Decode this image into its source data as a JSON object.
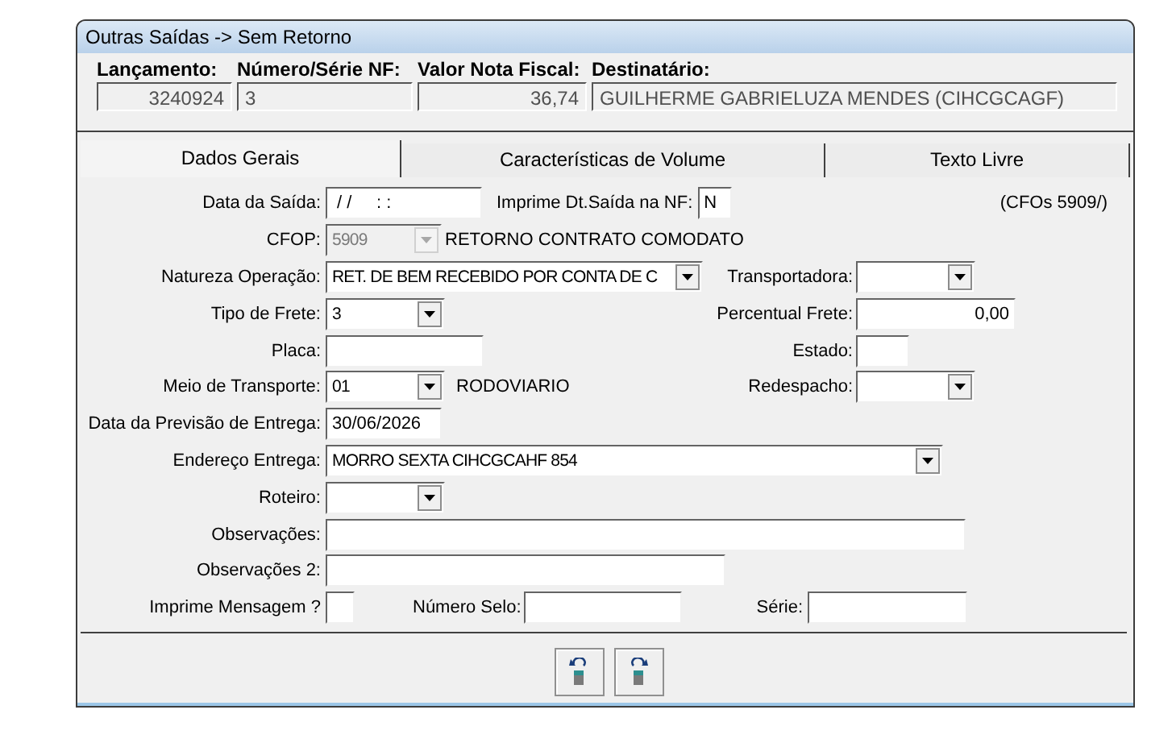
{
  "window": {
    "title": "Outras Saídas -> Sem Retorno"
  },
  "header": [
    {
      "label": "Lançamento:",
      "value": "3240924"
    },
    {
      "label": "Número/Série NF:",
      "value": "3"
    },
    {
      "label": "Valor Nota Fiscal:",
      "value": "36,74"
    },
    {
      "label": "Destinatário:",
      "value": "GUILHERME GABRIELUZA MENDES (CIHCGCAGF)"
    }
  ],
  "tabs": [
    {
      "label": "Dados Gerais",
      "selected": true
    },
    {
      "label": "Características de Volume",
      "selected": false
    },
    {
      "label": "Texto Livre",
      "selected": false
    }
  ],
  "form": {
    "data_saida": {
      "label": "Data da Saída:",
      "value": " / /     : :"
    },
    "imprime_data": {
      "label": "Imprime Dt.Saída na NF:",
      "value": "N"
    },
    "cfos_note": "(CFOs  5909/)",
    "cfop": {
      "label": "CFOP:",
      "value": "5909",
      "disabled": true,
      "description": "RETORNO CONTRATO COMODATO"
    },
    "natureza": {
      "label": "Natureza Operação:",
      "value": "RET. DE BEM RECEBIDO POR CONTA DE C"
    },
    "transportadora": {
      "label": "Transportadora:"
    },
    "tipo_frete": {
      "label": "Tipo de Frete:",
      "value": "3"
    },
    "percentual_frete": {
      "label": "Percentual Frete:",
      "value": "0,00"
    },
    "placa": {
      "label": "Placa:"
    },
    "estado": {
      "label": "Estado:"
    },
    "meio_transporte": {
      "label": "Meio de Transporte:",
      "value": "01",
      "description": "RODOVIARIO"
    },
    "redespacho": {
      "label": "Redespacho:"
    },
    "previsao_entrega": {
      "label": "Data da Previsão de Entrega:",
      "value": "30/06/2026"
    },
    "endereco_entrega": {
      "label": "Endereço Entrega:",
      "value": "MORRO SEXTA CIHCGCAHF 854"
    },
    "roteiro": {
      "label": "Roteiro:"
    },
    "observacoes": {
      "label": "Observações:"
    },
    "observacoes_2": {
      "label": "Observações 2:"
    },
    "imprime_mensagem": {
      "label": "Imprime Mensagem ?"
    },
    "numero_selo": {
      "label": "Número Selo:"
    },
    "serie": {
      "label": "Série:"
    }
  },
  "buttons": [
    {
      "kind": "undo"
    },
    {
      "kind": "redo"
    }
  ]
}
